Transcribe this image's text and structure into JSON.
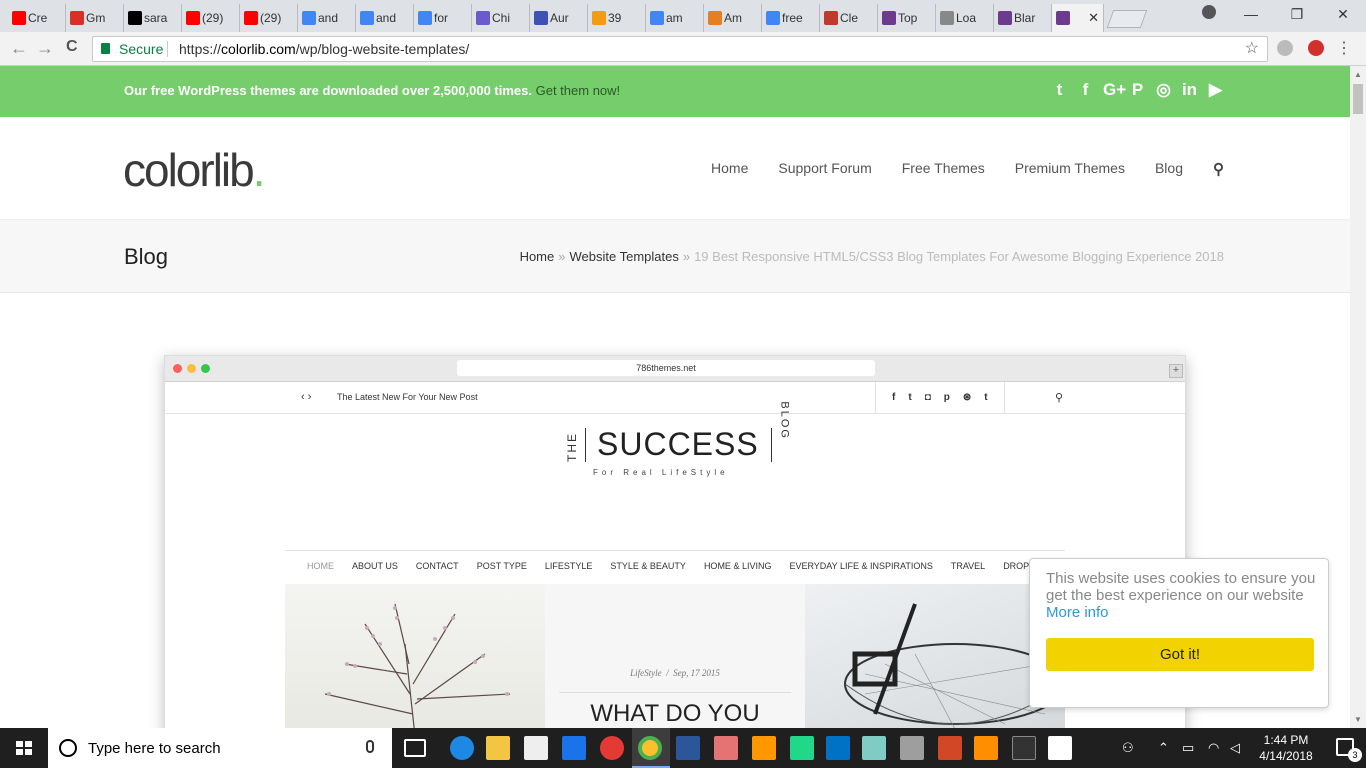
{
  "browser": {
    "tabs": [
      {
        "title": "Cre",
        "favicon": "youtube-icon",
        "color": "#ff0000"
      },
      {
        "title": "Gm",
        "favicon": "gmail-icon",
        "color": "#d93025"
      },
      {
        "title": "sara",
        "favicon": "github-icon",
        "color": "#000000"
      },
      {
        "title": "(29)",
        "favicon": "youtube-icon",
        "color": "#ff0000"
      },
      {
        "title": "(29)",
        "favicon": "youtube-icon",
        "color": "#ff0000"
      },
      {
        "title": "and",
        "favicon": "google-icon",
        "color": "#4285f4"
      },
      {
        "title": "and",
        "favicon": "google-icon",
        "color": "#4285f4"
      },
      {
        "title": "for",
        "favicon": "google-icon",
        "color": "#4285f4"
      },
      {
        "title": "Chi",
        "favicon": "globe-icon",
        "color": "#6a5acd"
      },
      {
        "title": "Aur",
        "favicon": "s-icon",
        "color": "#3f51b5"
      },
      {
        "title": "39",
        "favicon": "her-icon",
        "color": "#f39c12"
      },
      {
        "title": "am",
        "favicon": "google-icon",
        "color": "#4285f4"
      },
      {
        "title": "Am",
        "favicon": "fire-icon",
        "color": "#e67e22"
      },
      {
        "title": "free",
        "favicon": "google-icon",
        "color": "#4285f4"
      },
      {
        "title": "Cle",
        "favicon": "s-icon",
        "color": "#c0392b"
      },
      {
        "title": "Top",
        "favicon": "colorlib-icon",
        "color": "#6d3b8e"
      },
      {
        "title": "Loa",
        "favicon": "loading-icon",
        "color": "#888888"
      },
      {
        "title": "Blar",
        "favicon": "colorlib-icon",
        "color": "#6d3b8e"
      },
      {
        "title": "",
        "favicon": "colorlib-icon",
        "color": "#6d3b8e",
        "active": true
      }
    ],
    "close_glyph": "✕",
    "window_controls": {
      "minimize": "—",
      "maximize": "❐",
      "close": "✕"
    },
    "secure_label": "Secure",
    "url_scheme": "https://",
    "url_domain": "colorlib.com",
    "url_path": "/wp/blog-website-templates/",
    "star_glyph": "☆",
    "menu_glyph": "⋮",
    "back_glyph": "←",
    "forward_glyph": "→",
    "reload_glyph": "C"
  },
  "promo": {
    "text": "Our free WordPress themes are downloaded over 2,500,000 times.",
    "link": "Get them now!",
    "social": [
      "twitter-icon",
      "facebook-icon",
      "google-plus-icon",
      "pinterest-icon",
      "instagram-icon",
      "linkedin-icon",
      "youtube-icon"
    ],
    "social_glyphs": [
      "t",
      "f",
      "G+",
      "P",
      "◎",
      "in",
      "▶"
    ]
  },
  "header": {
    "logo": "colorlib",
    "logo_dot": ".",
    "nav": [
      "Home",
      "Support Forum",
      "Free Themes",
      "Premium Themes",
      "Blog"
    ],
    "search_glyph": "⚲"
  },
  "titlebar": {
    "title": "Blog",
    "crumbs": [
      "Home",
      "Website Templates"
    ],
    "sep": "»",
    "current": "19 Best Responsive HTML5/CSS3 Blog Templates For Awesome Blogging Experience 2018"
  },
  "mock": {
    "url": "786themes.net",
    "tagline": "The Latest New For Your New Post",
    "arrows": "‹   ›",
    "social": [
      "f",
      "t",
      "◘",
      "p",
      "⊛",
      "t"
    ],
    "search_glyph": "⚲",
    "logo_the": "THE",
    "logo_main": "SUCCESS",
    "logo_blog": "BLOG",
    "logo_tag": "For Real LifeStyle",
    "nav": [
      "HOME",
      "ABOUT US",
      "CONTACT",
      "POST TYPE",
      "LIFESTYLE",
      "STYLE & BEAUTY",
      "HOME & LIVING",
      "EVERYDAY LIFE & INSPIRATIONS",
      "TRAVEL",
      "DROPDOWN"
    ],
    "post_category": "LifeStyle",
    "post_date": "Sep, 17 2015",
    "post_title": "WHAT DO YOU"
  },
  "cookie": {
    "message": "This website uses cookies to ensure you get the best experience on our website",
    "more": "More info",
    "button": "Got it!"
  },
  "taskbar": {
    "search_placeholder": "Type here to search",
    "time": "1:44 PM",
    "date": "4/14/2018",
    "notification_count": "3"
  }
}
